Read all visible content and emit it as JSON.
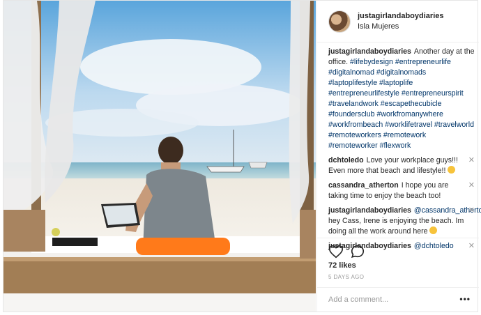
{
  "post": {
    "username": "justagirlandaboydiaries",
    "location": "Isla Mujeres",
    "caption": {
      "username": "justagirlandaboydiaries",
      "text": "Another day at the office.",
      "hashtags": "#lifebydesign #entrepreneurlife #digitalnomad #digitalnomads #laptoplifestyle #laptoplife #entrepreneurlifestyle #entrepreneurspirit #travelandwork #escapethecubicle #foundersclub #workfromanywhere #workfrombeach #worklifetravel #travelworld #remoteworkers #remotework #remoteworker #flexwork"
    },
    "comments": [
      {
        "username": "dchtoledo",
        "text": "Love your workplace guys!!! Even more that beach and lifestyle!!"
      },
      {
        "username": "cassandra_atherton",
        "text": "I hope you are taking time to enjoy the beach too!"
      },
      {
        "username": "justagirlandaboydiaries",
        "mention": "@cassandra_atherton",
        "text": "hey Cass, Irene is enjoying the beach. Im doing all the work around here"
      },
      {
        "username": "justagirlandaboydiaries",
        "mention": "@dchtoledo",
        "text": ""
      }
    ],
    "close_glyph": "✕",
    "likes": "72 likes",
    "time": "5 DAYS AGO",
    "add_comment_placeholder": "Add a comment...",
    "more_glyph": "•••",
    "icons": {
      "like": "heart-icon",
      "comment": "comment-bubble-icon"
    }
  }
}
